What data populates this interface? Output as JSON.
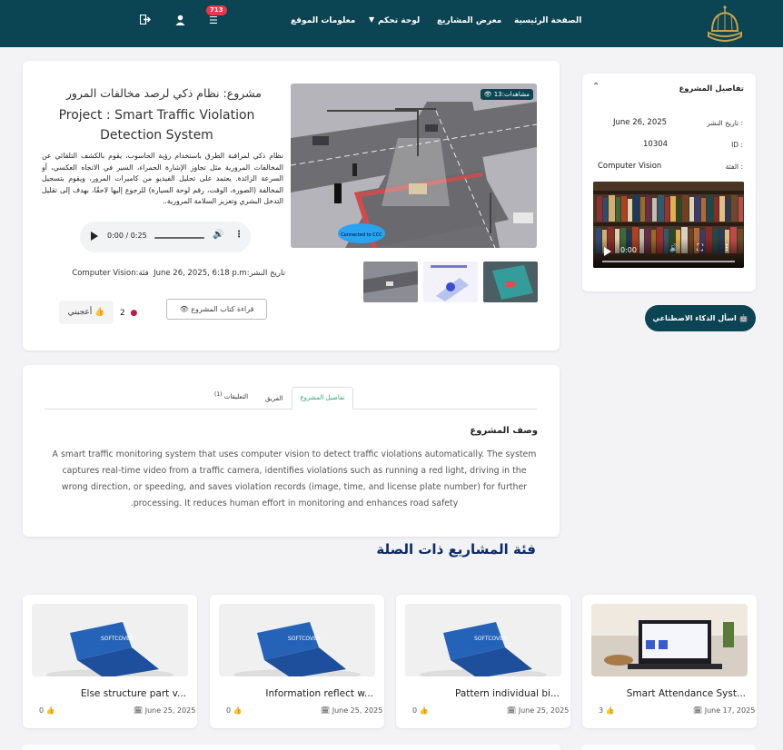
{
  "nav": {
    "items": [
      "الصفحة الرئيسية",
      "معرض المشاريع",
      "لوحة تحكم",
      "معلومات الموقع"
    ],
    "notifications_count": "713"
  },
  "project": {
    "title_ar": "مشروع: نظام ذكي لرصد مخالفات المرور",
    "title_en": "Project : Smart Traffic Violation Detection System",
    "description_ar": "نظام ذكي لمراقبة الطرق باستخدام رؤية الحاسوب، يقوم بالكشف التلقائي عن المخالفات المرورية مثل تجاوز الإشارة الحمراء، السير في الاتجاه العكسي، أو السرعة الزائدة. يعتمد على تحليل الفيديو من كاميرات المرور، ويقوم بتسجيل المخالفة (الصورة، الوقت، رقم لوحة السيارة) للرجوع إليها لاحقًا، بهدف إلى تقليل التدخل البشري وتعزيز السلامة المرورية..",
    "audio_time": "0:00 / 0:25",
    "date_label": "تاريخ النشر:",
    "date_value": "June 26, 2025, 6:18 p.m",
    "category_label": "فئة:",
    "category_value": "Computer Vision",
    "views_label": "مشاهدات:",
    "views_count": "13",
    "read_book_label": "قراءة كتاب المشروع",
    "comments_count": "2",
    "like_label": "أعجبني",
    "image_caption": "Connected to CCC"
  },
  "tabs": {
    "details": "تفاصيل المشروع",
    "team": "الفريق",
    "comments": "التعليقات",
    "comments_count": "(1)"
  },
  "description": {
    "heading": "وصف المشروع",
    "text": "A smart traffic monitoring system that uses computer vision to detect traffic violations automatically. The system captures real-time video from a traffic camera, identifies violations such as running a red light, driving in the wrong direction, or speeding, and saves violation records (image, time, and license plate number) for further processing. It reduces human effort in monitoring and enhances road safety."
  },
  "sidebar": {
    "title": "تفاصيل المشروع",
    "date_label": "تاريخ النشر :",
    "date_value": "June 26, 2025",
    "id_label": "ID :",
    "id_value": "10304",
    "category_label": "الفئة :",
    "category_value": "Computer Vision",
    "video_time": "0:00",
    "ai_button": "اسأل الذكاء الاصطناعي"
  },
  "related": {
    "heading": "فئة المشاريع ذات الصلة",
    "cards": [
      {
        "title": "Smart Attendance Syst...",
        "date": "June 17, 2025",
        "likes": "3"
      },
      {
        "title": "Pattern individual bi...",
        "date": "June 25, 2025",
        "likes": "0"
      },
      {
        "title": "Information reflect w...",
        "date": "June 25, 2025",
        "likes": "0"
      },
      {
        "title": "Else structure part v...",
        "date": "June 25, 2025",
        "likes": "0"
      }
    ]
  }
}
